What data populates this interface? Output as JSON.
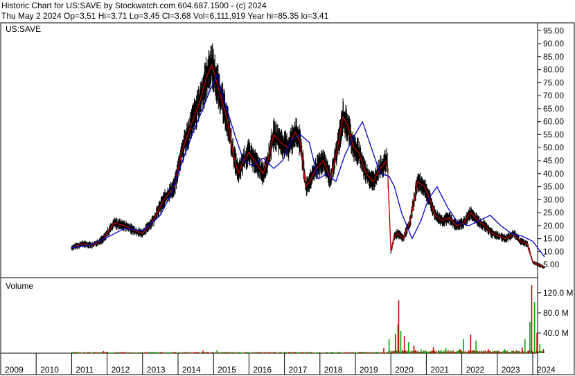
{
  "header": {
    "title": "Historic Chart for US:SAVE by Stockwatch.com 604.687.1500 - (c) 2024",
    "quote": "Thu May  2 2024  Op=3.51  Hi=3.71  Lo=3.45  Cl=3.68  Vol=6,111,919  Year hi=85.35  lo=3.41"
  },
  "chart_data": [
    {
      "type": "line",
      "symbol_label": "US:SAVE",
      "ylim": [
        0,
        98
      ],
      "y_ticks": [
        "95.00",
        "90.00",
        "85.00",
        "80.00",
        "75.00",
        "70.00",
        "65.00",
        "60.00",
        "55.00",
        "50.00",
        "45.00",
        "40.00",
        "35.00",
        "30.00",
        "25.00",
        "20.00",
        "15.00",
        "10.00",
        "5.00"
      ],
      "x_ticks": [
        "2009",
        "2010",
        "2011",
        "2012",
        "2013",
        "2014",
        "2015",
        "2016",
        "2017",
        "2018",
        "2019",
        "2020",
        "2021",
        "2022",
        "2023",
        "2024"
      ],
      "series": [
        {
          "color": "#cc0000",
          "x": [
            2011.0,
            2011.3,
            2011.6,
            2011.9,
            2012.2,
            2012.5,
            2012.8,
            2013.0,
            2013.3,
            2013.6,
            2013.9,
            2014.1,
            2014.4,
            2014.6,
            2014.8,
            2014.95,
            2015.2,
            2015.4,
            2015.55,
            2015.7,
            2015.85,
            2016.0,
            2016.2,
            2016.4,
            2016.55,
            2016.7,
            2016.9,
            2017.1,
            2017.3,
            2017.45,
            2017.6,
            2017.75,
            2017.9,
            2018.1,
            2018.3,
            2018.5,
            2018.65,
            2018.8,
            2018.95,
            2019.1,
            2019.3,
            2019.5,
            2019.7,
            2019.9,
            2020.0,
            2020.1,
            2020.2,
            2020.35,
            2020.55,
            2020.75,
            2020.95,
            2021.1,
            2021.25,
            2021.45,
            2021.65,
            2021.85,
            2022.05,
            2022.25,
            2022.45,
            2022.65,
            2022.85,
            2023.05,
            2023.25,
            2023.45,
            2023.65,
            2023.85,
            2024.0,
            2024.15,
            2024.33
          ],
          "y": [
            11.5,
            13,
            12.5,
            15,
            21,
            20,
            18,
            17,
            22,
            30,
            35,
            48,
            60,
            67,
            77,
            82,
            70,
            60,
            48,
            40,
            45,
            48,
            44,
            40,
            46,
            55,
            52,
            50,
            56,
            52,
            35,
            38,
            42,
            45,
            38,
            50,
            62,
            58,
            50,
            48,
            40,
            37,
            42,
            45,
            10,
            16,
            17,
            15,
            22,
            37,
            35,
            30,
            24,
            22,
            23,
            20,
            21,
            25,
            22,
            20,
            17,
            16,
            15,
            17,
            14,
            13,
            6,
            5,
            4
          ]
        },
        {
          "color": "#0000cc",
          "x": [
            2011.0,
            2011.5,
            2012.0,
            2012.5,
            2013.0,
            2013.5,
            2013.8,
            2014.1,
            2014.4,
            2014.7,
            2014.9,
            2015.1,
            2015.35,
            2015.6,
            2015.85,
            2016.1,
            2016.4,
            2016.7,
            2016.95,
            2017.2,
            2017.45,
            2017.7,
            2017.95,
            2018.2,
            2018.45,
            2018.7,
            2018.95,
            2019.2,
            2019.45,
            2019.7,
            2019.95,
            2020.1,
            2020.3,
            2020.6,
            2020.85,
            2021.05,
            2021.3,
            2021.6,
            2021.9,
            2022.2,
            2022.5,
            2022.8,
            2023.1,
            2023.4,
            2023.7,
            2024.0,
            2024.33
          ],
          "y": [
            11.5,
            12.5,
            15.5,
            19,
            18,
            24,
            32,
            44,
            55,
            65,
            72,
            78,
            66,
            55,
            45,
            43,
            46,
            42,
            45,
            53,
            55,
            52,
            38,
            40,
            37,
            47,
            54,
            60,
            50,
            40,
            39,
            35,
            25,
            15,
            22,
            30,
            35,
            27,
            21,
            20,
            22,
            24,
            20,
            17,
            16,
            14,
            8
          ]
        }
      ]
    },
    {
      "type": "bar",
      "label": "Volume",
      "ylim": [
        0,
        150
      ],
      "y_ticks": [
        "120.0 M",
        "80.0 M",
        "40.0 M"
      ],
      "spikes": [
        {
          "x": 2011.9,
          "v": 4
        },
        {
          "x": 2013.2,
          "v": 3
        },
        {
          "x": 2014.7,
          "v": 5
        },
        {
          "x": 2015.1,
          "v": 6
        },
        {
          "x": 2019.8,
          "v": 10
        },
        {
          "x": 2019.95,
          "v": 28
        },
        {
          "x": 2020.13,
          "v": 38
        },
        {
          "x": 2020.2,
          "v": 57
        },
        {
          "x": 2020.22,
          "v": 105
        },
        {
          "x": 2020.28,
          "v": 44
        },
        {
          "x": 2020.38,
          "v": 34
        },
        {
          "x": 2020.5,
          "v": 22
        },
        {
          "x": 2020.65,
          "v": 15
        },
        {
          "x": 2020.85,
          "v": 8
        },
        {
          "x": 2021.2,
          "v": 12
        },
        {
          "x": 2021.55,
          "v": 10
        },
        {
          "x": 2021.95,
          "v": 8
        },
        {
          "x": 2022.05,
          "v": 28
        },
        {
          "x": 2022.25,
          "v": 37
        },
        {
          "x": 2022.4,
          "v": 25
        },
        {
          "x": 2022.75,
          "v": 8
        },
        {
          "x": 2023.2,
          "v": 8
        },
        {
          "x": 2023.7,
          "v": 12
        },
        {
          "x": 2023.78,
          "v": 28
        },
        {
          "x": 2023.88,
          "v": 5
        },
        {
          "x": 2023.92,
          "v": 62
        },
        {
          "x": 2023.97,
          "v": 135
        },
        {
          "x": 2024.05,
          "v": 102
        },
        {
          "x": 2024.12,
          "v": 40
        },
        {
          "x": 2024.2,
          "v": 18
        },
        {
          "x": 2024.3,
          "v": 8
        }
      ]
    }
  ]
}
